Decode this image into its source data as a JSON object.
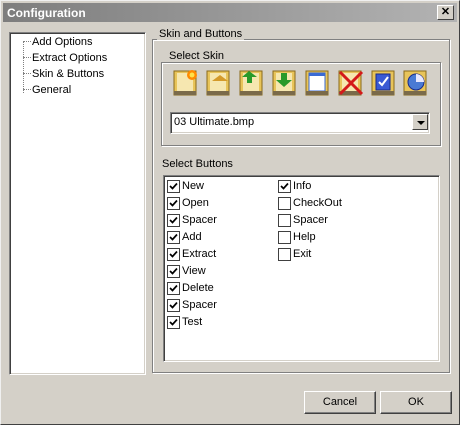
{
  "window": {
    "title": "Configuration"
  },
  "tree": {
    "items": [
      "Add Options",
      "Extract Options",
      "Skin & Buttons",
      "General"
    ]
  },
  "panel": {
    "title": "Skin and Buttons",
    "select_skin_label": "Select Skin",
    "skin_icons": [
      "new-archive-icon",
      "open-archive-icon",
      "add-files-icon",
      "extract-icon",
      "view-icon",
      "delete-icon",
      "test-icon",
      "info-icon"
    ],
    "skin_value": "03 Ultimate.bmp",
    "select_buttons_label": "Select Buttons"
  },
  "buttons_col1": [
    {
      "label": "New",
      "checked": true
    },
    {
      "label": "Open",
      "checked": true
    },
    {
      "label": "Spacer",
      "checked": true
    },
    {
      "label": "Add",
      "checked": true
    },
    {
      "label": "Extract",
      "checked": true
    },
    {
      "label": "View",
      "checked": true
    },
    {
      "label": "Delete",
      "checked": true
    },
    {
      "label": "Spacer",
      "checked": true
    },
    {
      "label": "Test",
      "checked": true
    }
  ],
  "buttons_col2": [
    {
      "label": "Info",
      "checked": true
    },
    {
      "label": "CheckOut",
      "checked": false
    },
    {
      "label": "Spacer",
      "checked": false
    },
    {
      "label": "Help",
      "checked": false
    },
    {
      "label": "Exit",
      "checked": false
    }
  ],
  "footer": {
    "cancel_label": "Cancel",
    "ok_label": "OK"
  }
}
